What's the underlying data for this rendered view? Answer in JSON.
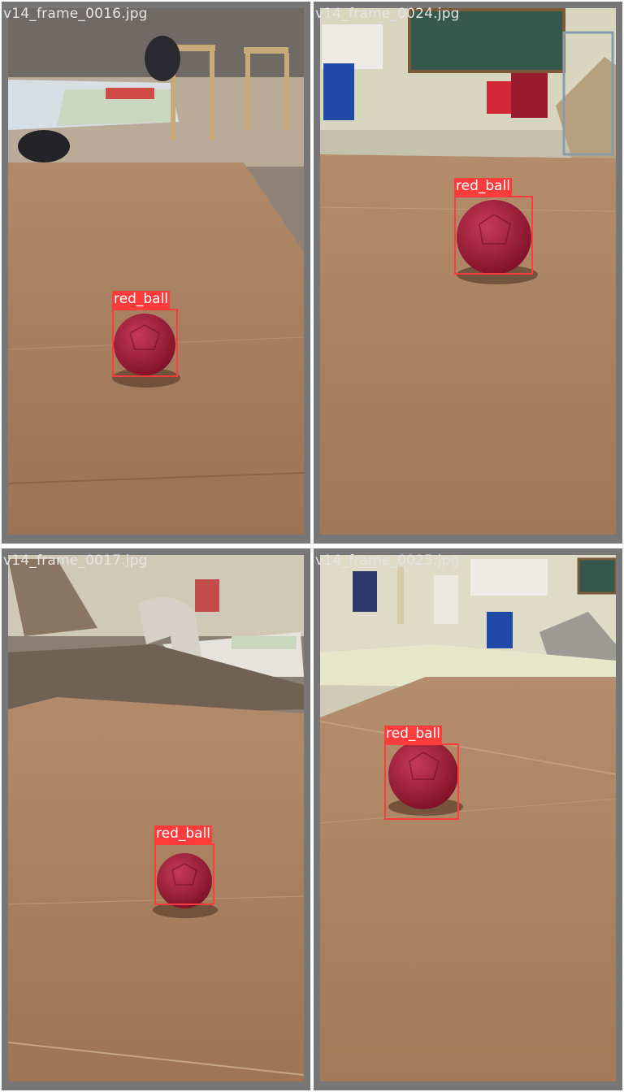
{
  "grid": {
    "frames": [
      {
        "filename": "v14_frame_0016.jpg",
        "detections": [
          {
            "label": "red_ball"
          }
        ]
      },
      {
        "filename": "v14_frame_0024.jpg",
        "detections": [
          {
            "label": "red_ball"
          }
        ]
      },
      {
        "filename": "v14_frame_0017.jpg",
        "detections": [
          {
            "label": "red_ball"
          }
        ]
      },
      {
        "filename": "v14_frame_0025.jpg",
        "detections": [
          {
            "label": "red_ball"
          }
        ]
      }
    ]
  },
  "colors": {
    "tile_border": "#777777",
    "box": "#ff3b3b",
    "filename_text": "#e4e4e4",
    "floor": "#a67d5b",
    "ball": "#a21d3a"
  }
}
